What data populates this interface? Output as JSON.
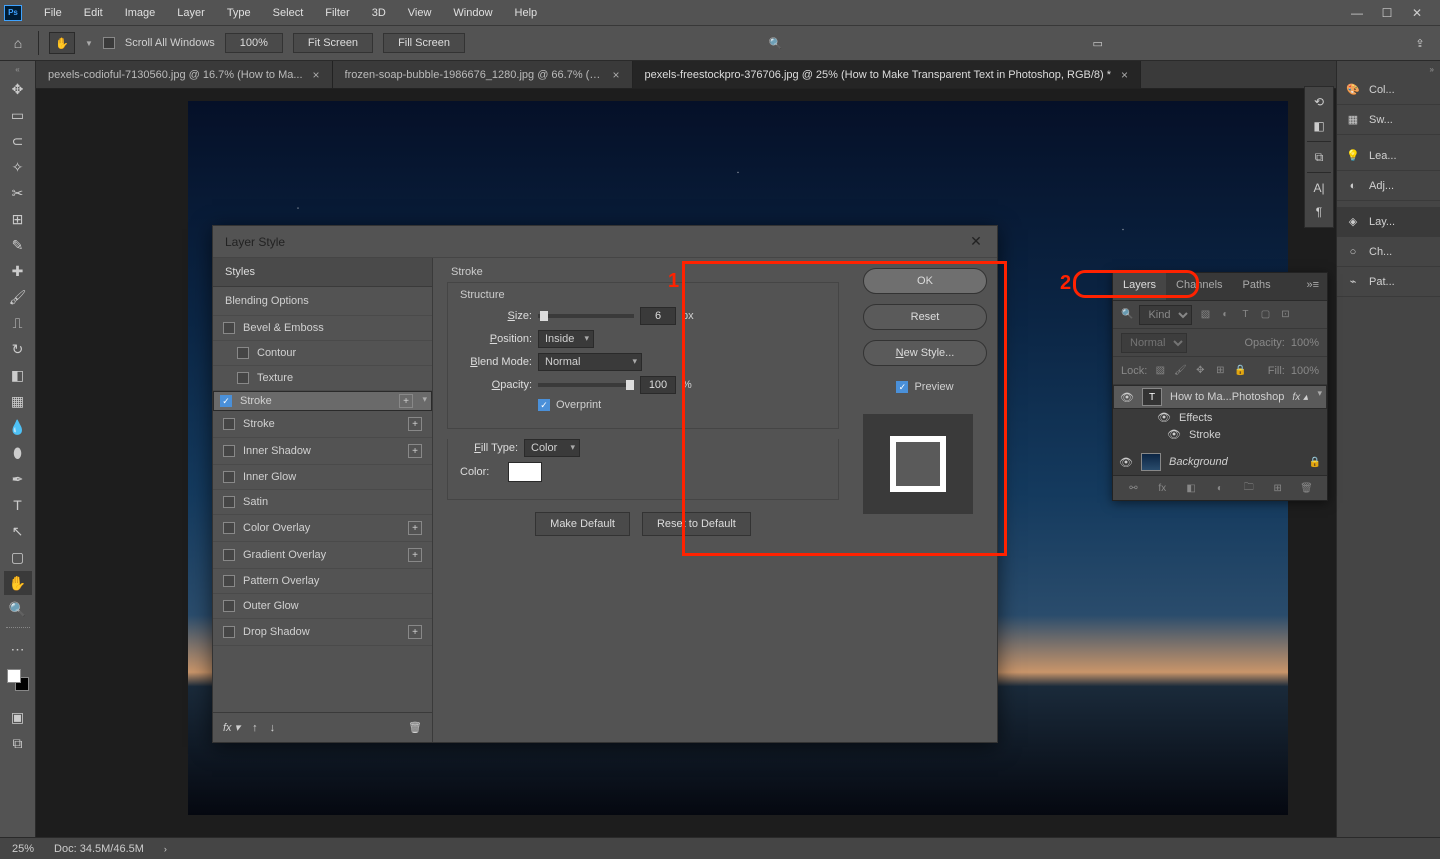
{
  "menubar": {
    "items": [
      "File",
      "Edit",
      "Image",
      "Layer",
      "Type",
      "Select",
      "Filter",
      "3D",
      "View",
      "Window",
      "Help"
    ]
  },
  "optionsbar": {
    "scroll_all": "Scroll All Windows",
    "zoom": "100%",
    "fit_screen": "Fit Screen",
    "fill_screen": "Fill Screen"
  },
  "tabs": [
    {
      "label": "pexels-codioful-7130560.jpg @ 16.7% (How to Ma...",
      "active": false
    },
    {
      "label": "frozen-soap-bubble-1986676_1280.jpg @ 66.7% (R...",
      "active": false
    },
    {
      "label": "pexels-freestockpro-376706.jpg @ 25% (How to Make Transparent Text in Photoshop, RGB/8) *",
      "active": true
    }
  ],
  "right_panels": [
    {
      "icon": "palette-icon",
      "label": "Col..."
    },
    {
      "icon": "swatches-icon",
      "label": "Sw..."
    },
    {
      "icon": "learn-icon",
      "label": "Lea..."
    },
    {
      "icon": "half-circle-icon",
      "label": "Adj..."
    },
    {
      "icon": "layers-stack-icon",
      "label": "Lay..."
    },
    {
      "icon": "circle-icon",
      "label": "Ch..."
    },
    {
      "icon": "path-icon",
      "label": "Pat..."
    }
  ],
  "layers_panel": {
    "tabs": [
      "Layers",
      "Channels",
      "Paths"
    ],
    "kind_placeholder": "Kind",
    "blend_mode": "Normal",
    "opacity_label": "Opacity:",
    "opacity_value": "100%",
    "lock_label": "Lock:",
    "fill_label": "Fill:",
    "fill_value": "100%",
    "layer0": {
      "name": "How to Ma...Photoshop",
      "effects": "Effects",
      "stroke": "Stroke"
    },
    "layer1": {
      "name": "Background"
    }
  },
  "statusbar": {
    "zoom": "25%",
    "doc": "Doc: 34.5M/46.5M"
  },
  "dialog": {
    "title": "Layer Style",
    "styles_header": "Styles",
    "blending_options": "Blending Options",
    "styles": [
      {
        "label": "Bevel & Emboss",
        "on": false,
        "plus": false,
        "sub": false
      },
      {
        "label": "Contour",
        "on": false,
        "plus": false,
        "sub": true
      },
      {
        "label": "Texture",
        "on": false,
        "plus": false,
        "sub": true
      },
      {
        "label": "Stroke",
        "on": true,
        "plus": true,
        "sub": false,
        "sel": true
      },
      {
        "label": "Stroke",
        "on": false,
        "plus": true,
        "sub": false
      },
      {
        "label": "Inner Shadow",
        "on": false,
        "plus": true,
        "sub": false
      },
      {
        "label": "Inner Glow",
        "on": false,
        "plus": false,
        "sub": false
      },
      {
        "label": "Satin",
        "on": false,
        "plus": false,
        "sub": false
      },
      {
        "label": "Color Overlay",
        "on": false,
        "plus": true,
        "sub": false
      },
      {
        "label": "Gradient Overlay",
        "on": false,
        "plus": true,
        "sub": false
      },
      {
        "label": "Pattern Overlay",
        "on": false,
        "plus": false,
        "sub": false
      },
      {
        "label": "Outer Glow",
        "on": false,
        "plus": false,
        "sub": false
      },
      {
        "label": "Drop Shadow",
        "on": false,
        "plus": true,
        "sub": false
      }
    ],
    "settings": {
      "heading": "Stroke",
      "structure": "Structure",
      "size_label": "Size:",
      "size_value": "6",
      "size_unit": "px",
      "position_label": "Position:",
      "position_value": "Inside",
      "blend_label": "Blend Mode:",
      "blend_value": "Normal",
      "opacity_label": "Opacity:",
      "opacity_value": "100",
      "opacity_unit": "%",
      "overprint": "Overprint",
      "fill_type_label": "Fill Type:",
      "fill_type_value": "Color",
      "color_label": "Color:"
    },
    "make_default": "Make Default",
    "reset_default": "Reset to Default",
    "actions": {
      "ok": "OK",
      "reset": "Reset",
      "new_style": "New Style...",
      "preview": "Preview"
    }
  },
  "annotations": {
    "one": "1",
    "two": "2"
  }
}
